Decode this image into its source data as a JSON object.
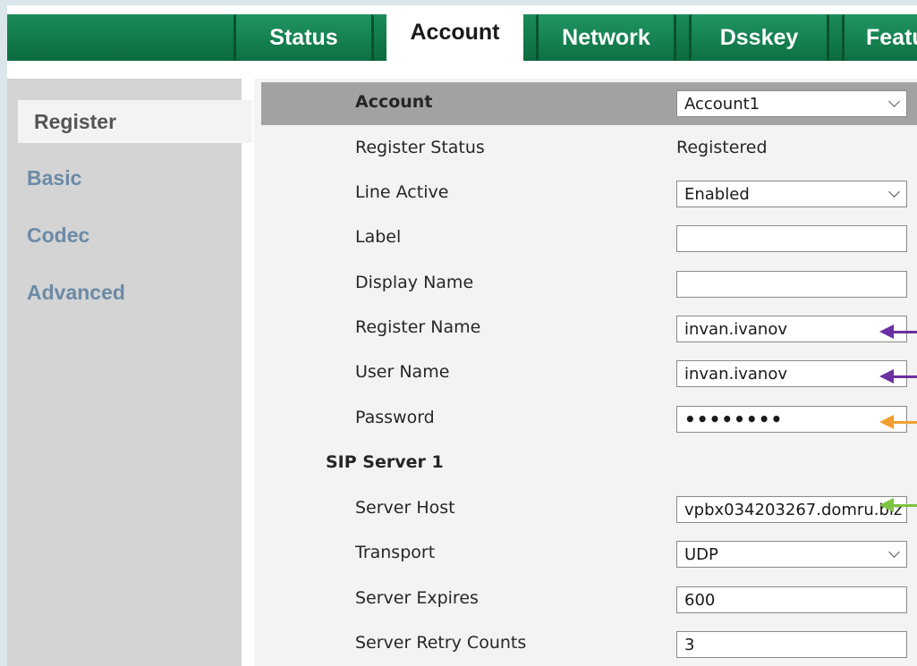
{
  "tabs": [
    {
      "label": "Status"
    },
    {
      "label": "Account"
    },
    {
      "label": "Network"
    },
    {
      "label": "Dsskey"
    },
    {
      "label": "Featu"
    }
  ],
  "sidebar": {
    "items": [
      {
        "label": "Register"
      },
      {
        "label": "Basic"
      },
      {
        "label": "Codec"
      },
      {
        "label": "Advanced"
      }
    ]
  },
  "form": {
    "account": {
      "label": "Account",
      "value": "Account1"
    },
    "register_status": {
      "label": "Register Status",
      "value": "Registered"
    },
    "line_active": {
      "label": "Line Active",
      "value": "Enabled"
    },
    "label_field": {
      "label": "Label",
      "value": ""
    },
    "display_name": {
      "label": "Display Name",
      "value": ""
    },
    "register_name": {
      "label": "Register Name",
      "value": "invan.ivanov"
    },
    "user_name": {
      "label": "User Name",
      "value": "invan.ivanov"
    },
    "password": {
      "label": "Password",
      "value": "••••••••"
    },
    "sip_server_heading": "SIP Server 1",
    "server_host": {
      "label": "Server Host",
      "value": "vpbx034203267.domru.biz"
    },
    "transport": {
      "label": "Transport",
      "value": "UDP"
    },
    "server_expires": {
      "label": "Server Expires",
      "value": "600"
    },
    "server_retry_counts": {
      "label": "Server Retry Counts",
      "value": "3"
    }
  },
  "annotation_colors": {
    "purple": "#6a2fa0",
    "orange": "#f0a030",
    "green": "#7cc442"
  }
}
